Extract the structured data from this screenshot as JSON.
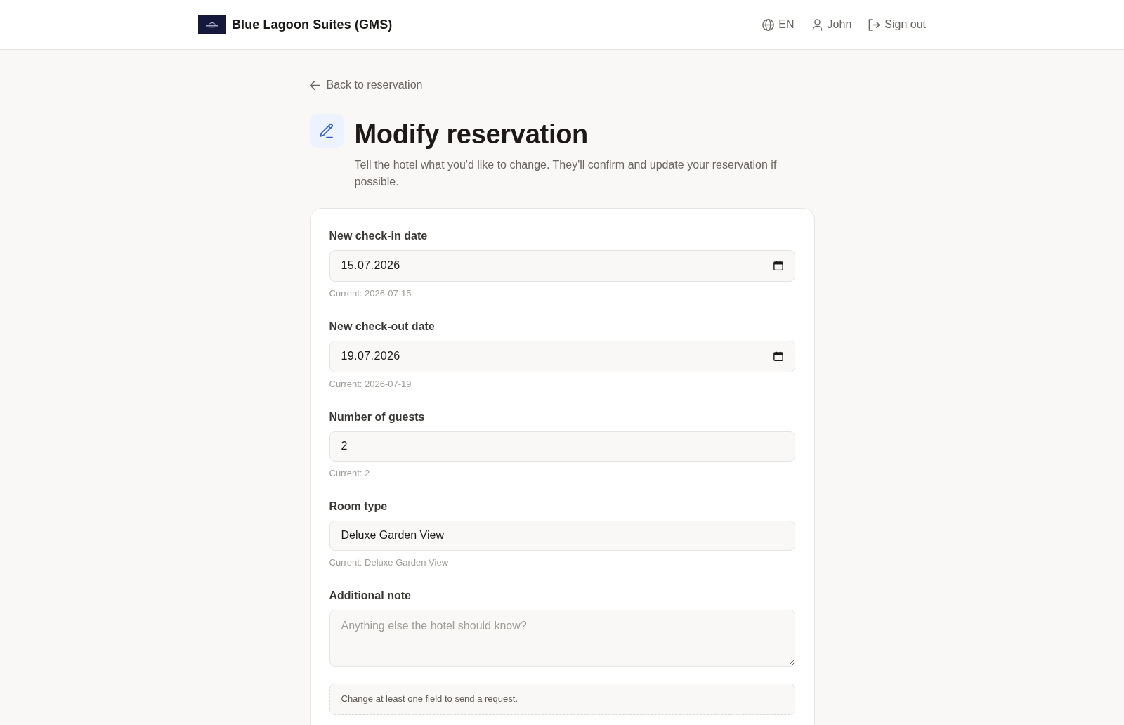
{
  "header": {
    "brand": "Blue Lagoon Suites (GMS)",
    "language": "EN",
    "user": "John",
    "sign_out": "Sign out"
  },
  "back_link": "Back to reservation",
  "page": {
    "title": "Modify reservation",
    "subtitle": "Tell the hotel what you'd like to change. They'll confirm and update your reservation if possible."
  },
  "form": {
    "fields": [
      {
        "kind": "date",
        "label": "New check-in date",
        "value": "15.07.2026",
        "current": "Current: 2026-07-15"
      },
      {
        "kind": "date",
        "label": "New check-out date",
        "value": "19.07.2026",
        "current": "Current: 2026-07-19"
      },
      {
        "kind": "text",
        "label": "Number of guests",
        "value": "2",
        "current": "Current: 2"
      },
      {
        "kind": "text",
        "label": "Room type",
        "value": "Deluxe Garden View",
        "current": "Current: Deluxe Garden View"
      },
      {
        "kind": "textarea",
        "label": "Additional note",
        "placeholder": "Anything else the hotel should know?"
      }
    ],
    "notice": "Change at least one field to send a request."
  }
}
